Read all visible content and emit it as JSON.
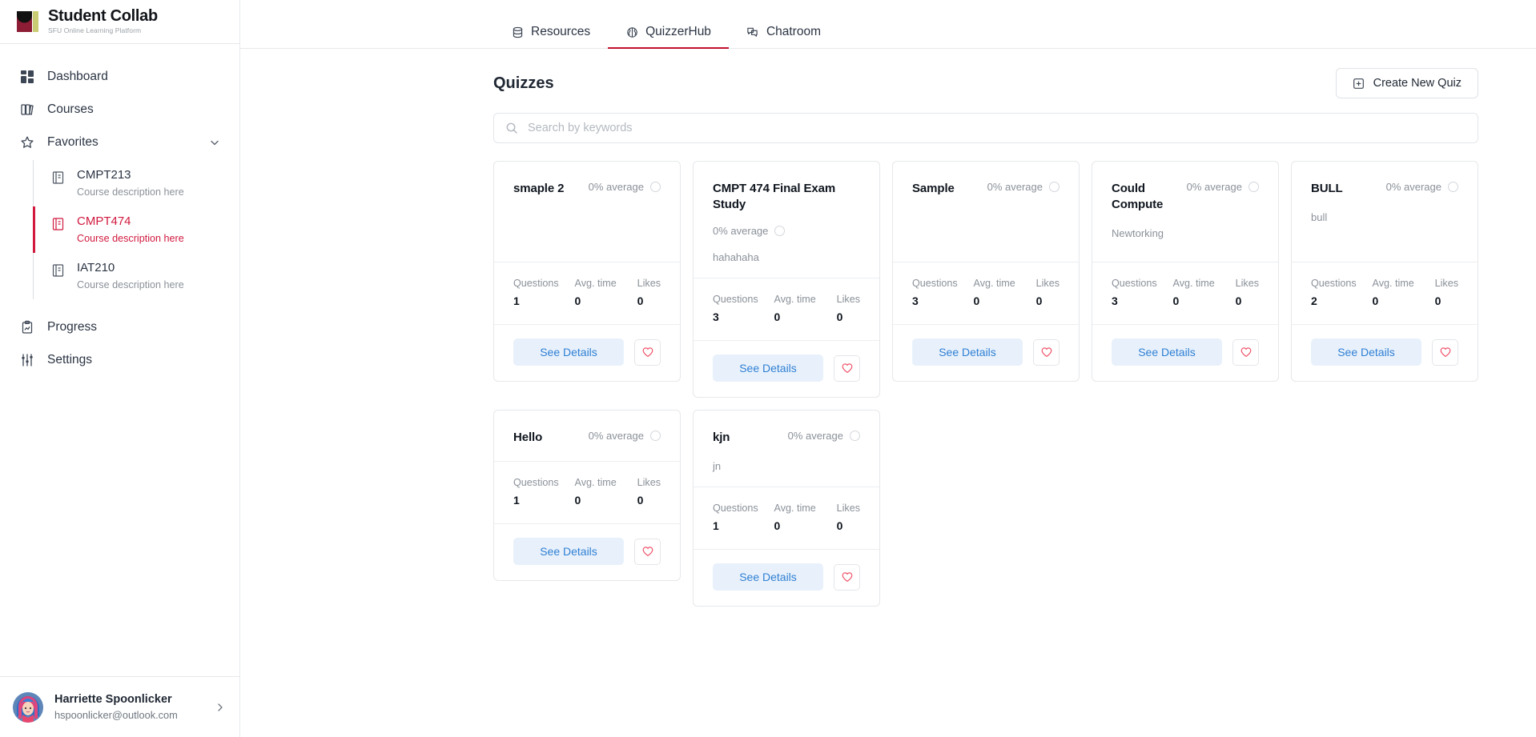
{
  "brand": {
    "title": "Student Collab",
    "subtitle": "SFU Online Learning Platform",
    "logo_icon": "student-collab-logo",
    "colors": {
      "maroon": "#8c1d35",
      "olive": "#c9cc72",
      "accent_red": "#d1193e"
    }
  },
  "sidebar": {
    "items": [
      {
        "label": "Dashboard",
        "icon": "dashboard-grid-icon"
      },
      {
        "label": "Courses",
        "icon": "books-icon"
      },
      {
        "label": "Favorites",
        "icon": "star-icon",
        "chevron": "chevron-down-icon"
      }
    ],
    "courses": [
      {
        "title": "CMPT213",
        "desc": "Course description here",
        "icon": "book-icon",
        "active": false
      },
      {
        "title": "CMPT474",
        "desc": "Course description here",
        "icon": "book-icon",
        "active": true
      },
      {
        "title": "IAT210",
        "desc": "Course description here",
        "icon": "book-icon",
        "active": false
      }
    ],
    "bottom_items": [
      {
        "label": "Progress",
        "icon": "clipboard-icon"
      },
      {
        "label": "Settings",
        "icon": "sliders-icon"
      }
    ],
    "user": {
      "name": "Harriette Spoonlicker",
      "email": "hspoonlicker@outlook.com",
      "avatar_icon": "user-avatar",
      "chevron": "chevron-right-icon"
    }
  },
  "tabs": [
    {
      "label": "Resources",
      "icon": "database-icon",
      "active": false
    },
    {
      "label": "QuizzerHub",
      "icon": "brain-icon",
      "active": true
    },
    {
      "label": "Chatroom",
      "icon": "chat-bubbles-icon",
      "active": false
    }
  ],
  "page": {
    "title": "Quizzes",
    "create_button": {
      "label": "Create New Quiz",
      "icon": "square-plus-icon"
    },
    "search": {
      "value": "",
      "placeholder": "Search by keywords",
      "icon": "search-icon"
    }
  },
  "card_labels": {
    "questions": "Questions",
    "avg_time": "Avg. time",
    "likes": "Likes",
    "see_details": "See Details",
    "favorite_icon": "heart-icon",
    "average_ring_icon": "progress-ring-icon"
  },
  "quizzes": [
    {
      "title": "smaple 2",
      "average": "0% average",
      "description": "",
      "avg_below_title": false,
      "questions": "1",
      "avg_time": "0",
      "likes": "0"
    },
    {
      "title": "CMPT 474 Final Exam Study",
      "average": "0% average",
      "description": "hahahaha",
      "avg_below_title": true,
      "questions": "3",
      "avg_time": "0",
      "likes": "0"
    },
    {
      "title": "Sample",
      "average": "0% average",
      "description": "",
      "avg_below_title": false,
      "questions": "3",
      "avg_time": "0",
      "likes": "0"
    },
    {
      "title": "Could Compute",
      "average": "0% average",
      "description": "Newtorking",
      "avg_below_title": false,
      "questions": "3",
      "avg_time": "0",
      "likes": "0"
    },
    {
      "title": "BULL",
      "average": "0% average",
      "description": "bull",
      "avg_below_title": false,
      "questions": "2",
      "avg_time": "0",
      "likes": "0"
    },
    {
      "title": "Hello",
      "average": "0% average",
      "description": "",
      "avg_below_title": false,
      "questions": "1",
      "avg_time": "0",
      "likes": "0"
    },
    {
      "title": "kjn",
      "average": "0% average",
      "description": "jn",
      "avg_below_title": false,
      "questions": "1",
      "avg_time": "0",
      "likes": "0"
    }
  ]
}
